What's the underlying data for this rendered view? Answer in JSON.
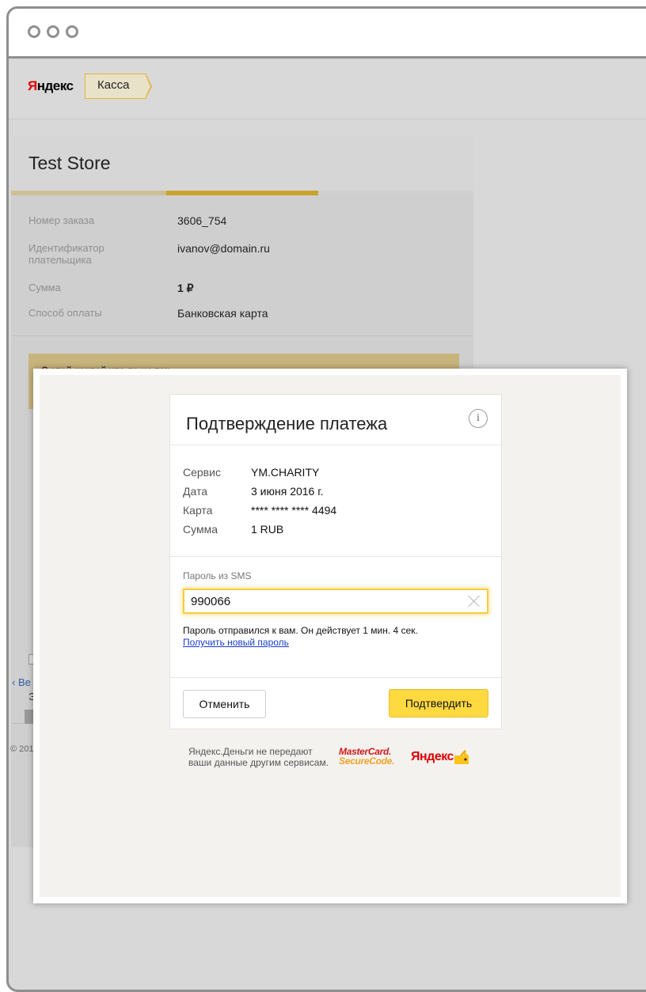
{
  "browser": {
    "dots": [
      "",
      "",
      ""
    ]
  },
  "header": {
    "logo_ya": "Я",
    "logo_rest": "ндекс",
    "tab_label": "Касса"
  },
  "store": {
    "title": "Test Store",
    "rows": [
      {
        "label": "Номер заказа",
        "value": "3606_754"
      },
      {
        "label": "Идентификатор плательщика",
        "value": "ivanov@domain.ru"
      },
      {
        "label": "Сумма",
        "value": "1 ₽"
      },
      {
        "label": "Способ оплаты",
        "value": "Банковская карта"
      }
    ],
    "warning_text": "С этой картой что-то не так",
    "back_link": "‹ Ве",
    "footer_copy": "© 201",
    "fragment_e": "Э."
  },
  "dialog": {
    "title": "Подтверждение платежа",
    "info_glyph": "i",
    "details": [
      {
        "label": "Сервис",
        "value": "YM.CHARITY"
      },
      {
        "label": "Дата",
        "value": "3 июня 2016 г."
      },
      {
        "label": "Карта",
        "value": "**** **** **** 4494"
      },
      {
        "label": "Сумма",
        "value": "1 RUB"
      }
    ],
    "sms_label": "Пароль из SMS",
    "sms_value": "990066",
    "sent_text": "Пароль отправился к вам. Он действует 1 мин. 4 сек.",
    "new_password_link": "Получить новый пароль",
    "cancel_label": "Отменить",
    "confirm_label": "Подтвердить"
  },
  "footer": {
    "privacy_text": "Яндекс.Деньги не передают ваши данные другим сервисам.",
    "mc_line1": "MasterCard.",
    "mc_line2": "SecureCode.",
    "ya_logo": "Яндекс"
  },
  "colors": {
    "accent": "#ffd940",
    "link": "#1a3dd1",
    "brand_red": "#e00000"
  }
}
